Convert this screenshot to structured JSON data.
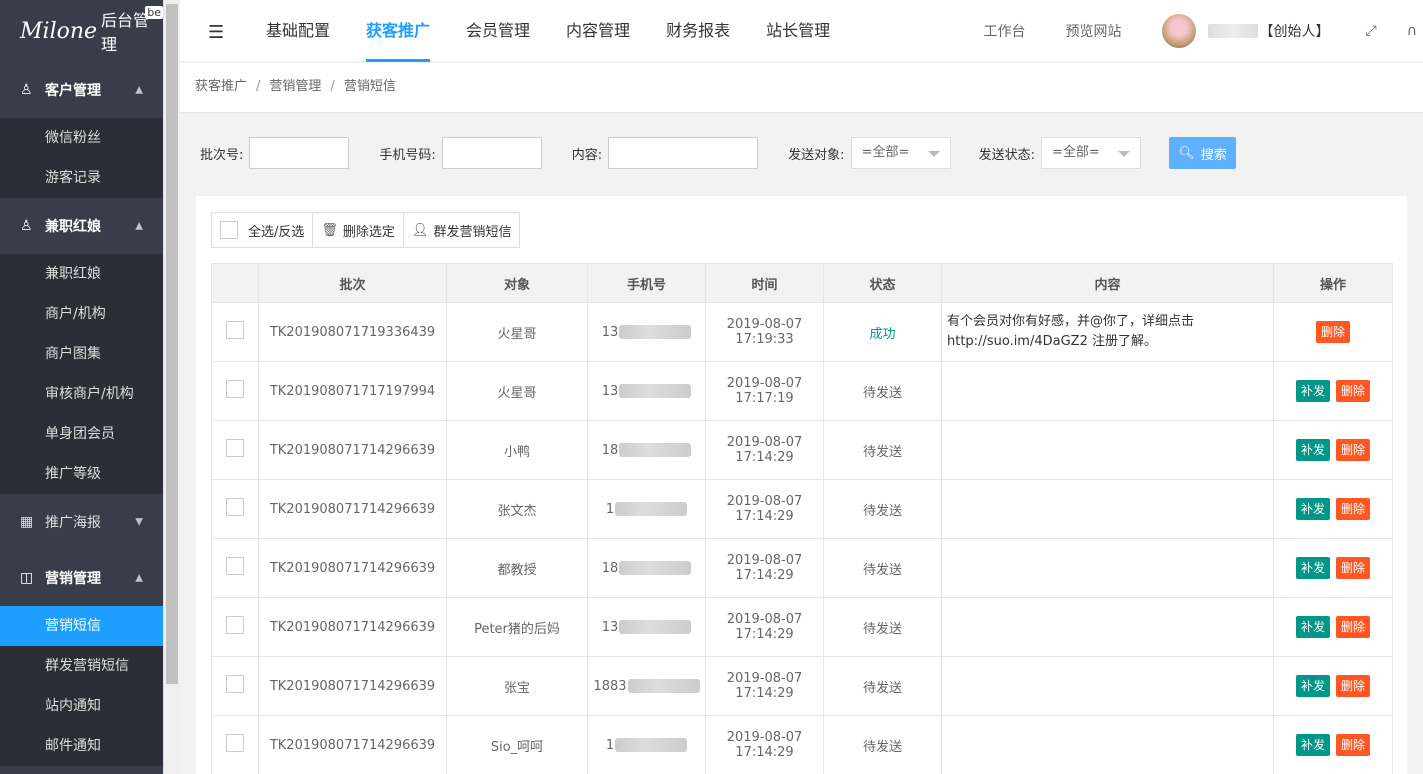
{
  "app": {
    "brand_script": "Milone",
    "title": "后台管理",
    "badge": "be"
  },
  "sidebar": {
    "groups": [
      {
        "label": "客户管理",
        "icon": "users-icon",
        "items": [
          "微信粉丝",
          "游客记录"
        ]
      },
      {
        "label": "兼职红娘",
        "icon": "users-icon",
        "items": [
          "兼职红娘",
          "商户/机构",
          "商户图集",
          "审核商户/机构",
          "单身团会员",
          "推广等级"
        ]
      },
      {
        "label": "推广海报",
        "icon": "calendar-icon",
        "items": []
      },
      {
        "label": "营销管理",
        "icon": "chart-icon",
        "items": [
          "营销短信",
          "群发营销短信",
          "站内通知",
          "邮件通知"
        ]
      }
    ],
    "active_item": "营销短信"
  },
  "header": {
    "tabs": [
      "基础配置",
      "获客推广",
      "会员管理",
      "内容管理",
      "财务报表",
      "站长管理"
    ],
    "active_tab": "获客推广",
    "links": [
      "工作台",
      "预览网站"
    ],
    "user_role": "【创始人】"
  },
  "breadcrumb": [
    "获客推广",
    "营销管理",
    "营销短信"
  ],
  "filters": {
    "batch_label": "批次号:",
    "phone_label": "手机号码:",
    "content_label": "内容:",
    "target_label": "发送对象:",
    "target_value": "=全部=",
    "status_label": "发送状态:",
    "status_value": "=全部=",
    "search_label": "搜索"
  },
  "toolbar": {
    "select_all": "全选/反选",
    "delete_selected": "删除选定",
    "bulk_sms": "群发营销短信"
  },
  "table": {
    "headers": [
      "批次",
      "对象",
      "手机号",
      "时间",
      "状态",
      "内容",
      "操作"
    ],
    "rows": [
      {
        "batch": "TK201908071719336439",
        "target": "火星哥",
        "phone": "13",
        "date": "2019-08-07",
        "time": "17:19:33",
        "status": "成功",
        "content": "有个会员对你有好感，并@你了，详细点击http://suo.im/4DaGZ2 注册了解。",
        "resend": false
      },
      {
        "batch": "TK201908071717197994",
        "target": "火星哥",
        "phone": "13",
        "date": "2019-08-07",
        "time": "17:17:19",
        "status": "待发送",
        "content": "",
        "resend": true
      },
      {
        "batch": "TK201908071714296639",
        "target": "小鸭",
        "phone": "18",
        "date": "2019-08-07",
        "time": "17:14:29",
        "status": "待发送",
        "content": "",
        "resend": true
      },
      {
        "batch": "TK201908071714296639",
        "target": "张文杰",
        "phone": "1",
        "date": "2019-08-07",
        "time": "17:14:29",
        "status": "待发送",
        "content": "",
        "resend": true
      },
      {
        "batch": "TK201908071714296639",
        "target": "都教授",
        "phone": "18",
        "date": "2019-08-07",
        "time": "17:14:29",
        "status": "待发送",
        "content": "",
        "resend": true
      },
      {
        "batch": "TK201908071714296639",
        "target": "Peter猪的后妈",
        "phone": "13",
        "date": "2019-08-07",
        "time": "17:14:29",
        "status": "待发送",
        "content": "",
        "resend": true
      },
      {
        "batch": "TK201908071714296639",
        "target": "张宝",
        "phone": "1883",
        "date": "2019-08-07",
        "time": "17:14:29",
        "status": "待发送",
        "content": "",
        "resend": true
      },
      {
        "batch": "TK201908071714296639",
        "target": "Sio_呵呵",
        "phone": "1",
        "date": "2019-08-07",
        "time": "17:14:29",
        "status": "待发送",
        "content": "",
        "resend": true
      }
    ],
    "resend_label": "补发",
    "delete_label": "删除"
  },
  "colors": {
    "sidebar_bg": "#393d49",
    "accent": "#1e9fff",
    "success": "#009688",
    "danger": "#ff5722"
  }
}
